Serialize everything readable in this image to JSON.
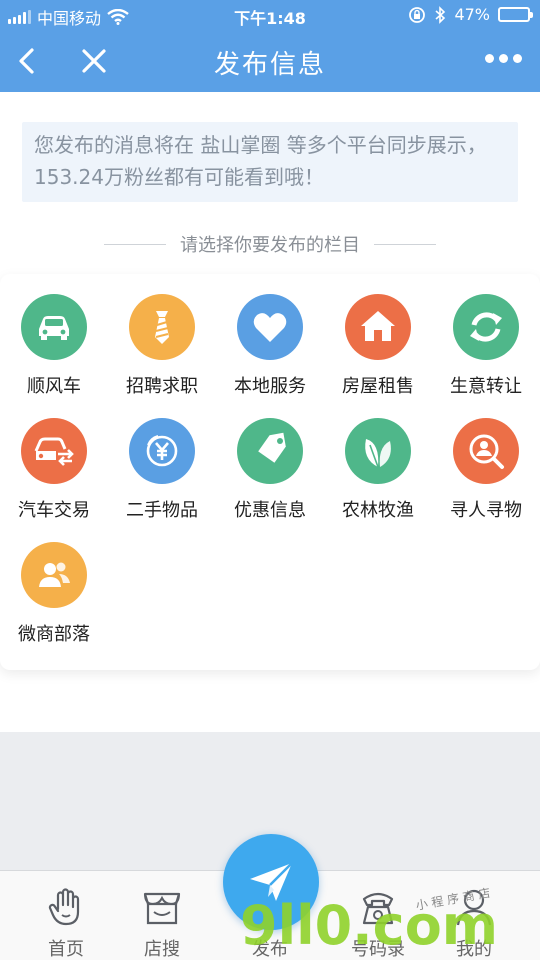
{
  "status": {
    "carrier": "中国移动",
    "time": "下午1:48",
    "battery": "47%",
    "battery_level": 0.47
  },
  "nav": {
    "title": "发布信息"
  },
  "notice": {
    "text": "您发布的消息将在 盐山掌圈 等多个平台同步展示，153.24万粉丝都有可能看到哦！"
  },
  "section": {
    "heading": "请选择你要发布的栏目"
  },
  "categories": [
    {
      "label": "顺风车",
      "icon": "car-icon",
      "color": "#4fb78a"
    },
    {
      "label": "招聘求职",
      "icon": "tie-icon",
      "color": "#f5b04a"
    },
    {
      "label": "本地服务",
      "icon": "heart-icon",
      "color": "#5a9fe3"
    },
    {
      "label": "房屋租售",
      "icon": "house-icon",
      "color": "#ec6f47"
    },
    {
      "label": "生意转让",
      "icon": "refresh-icon",
      "color": "#4fb78a"
    },
    {
      "label": "汽车交易",
      "icon": "car-trade-icon",
      "color": "#ec6f47"
    },
    {
      "label": "二手物品",
      "icon": "yuan-icon",
      "color": "#5a9fe3"
    },
    {
      "label": "优惠信息",
      "icon": "tag-icon",
      "color": "#4fb78a"
    },
    {
      "label": "农林牧渔",
      "icon": "leaf-icon",
      "color": "#4fb78a"
    },
    {
      "label": "寻人寻物",
      "icon": "search-person-icon",
      "color": "#ec6f47"
    },
    {
      "label": "微商部落",
      "icon": "people-icon",
      "color": "#f5b04a"
    }
  ],
  "tabs": [
    {
      "label": "首页",
      "icon": "hand-icon"
    },
    {
      "label": "店搜",
      "icon": "shop-icon"
    },
    {
      "label": "发布",
      "icon": "paper-plane-icon"
    },
    {
      "label": "号码录",
      "icon": "phone-icon"
    },
    {
      "label": "我的",
      "icon": "user-icon"
    }
  ],
  "watermark": {
    "logo": "9ll0.com",
    "slogan": "小 程 序 商 店"
  }
}
